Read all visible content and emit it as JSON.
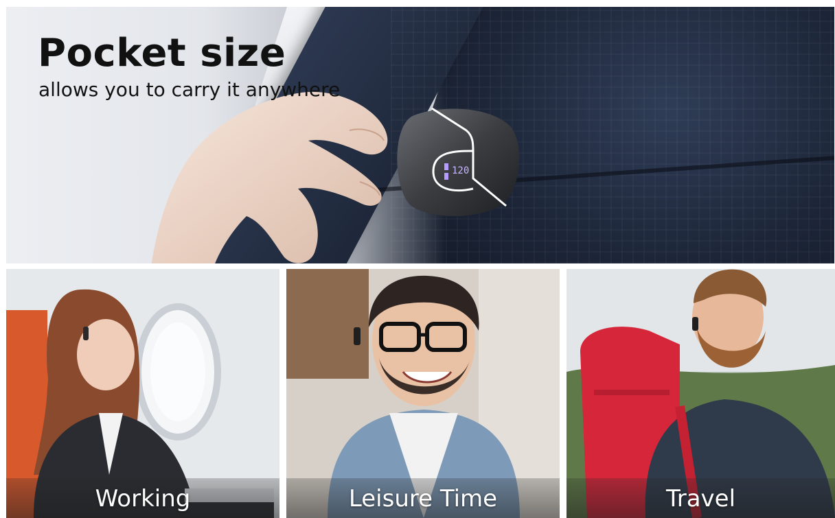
{
  "hero": {
    "title": "Pocket size",
    "subtitle": "allows you to carry it anywhere",
    "case_display": "120"
  },
  "panels": [
    {
      "label": "Working"
    },
    {
      "label": "Leisure Time"
    },
    {
      "label": "Travel"
    }
  ]
}
